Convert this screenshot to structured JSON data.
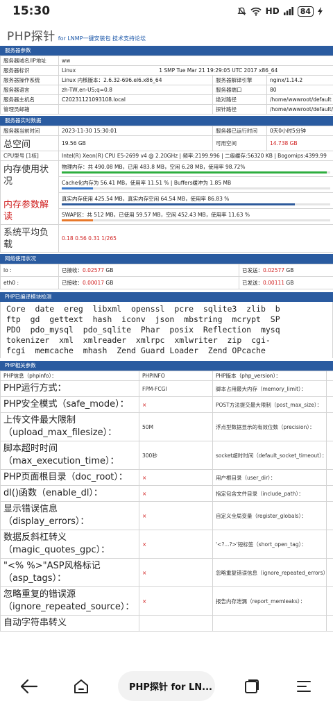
{
  "status_bar": {
    "time": "15:30",
    "network": "HD",
    "battery": "84"
  },
  "header": {
    "title": "PHP探针",
    "links": "for LNMP一键安装包 技术支持论坛"
  },
  "server_params": {
    "section": "服务器参数",
    "rows": [
      [
        "服务器域名/IP地址",
        "ww",
        "",
        ""
      ],
      [
        "服务器标识",
        "Linux",
        "1 SMP Tue Mar 21 19:29:05 UTC 2017 x86_64",
        ""
      ],
      [
        "服务器操作系统",
        "Linux 内核版本：2.6.32-696.el6.x86_64",
        "服务器解译引擎",
        "nginx/1.14.2"
      ],
      [
        "服务器语言",
        "zh-TW,en-US;q=0.8",
        "服务器端口",
        "80"
      ],
      [
        "服务器主机名",
        "C20231121093108.local",
        "绝对路径",
        "/home/wwwroot/default"
      ],
      [
        "管理员邮箱",
        "",
        "探针路径",
        "/home/wwwroot/default/p"
      ]
    ]
  },
  "realtime": {
    "section": "服务器实时数据",
    "time_label": "服务器当前时间",
    "time_value": "2023-11-30 15:30:01",
    "uptime_label": "服务器已运行时间",
    "uptime_value": "0天0小时5分钟",
    "space_label": "总空间",
    "space_value": "19.56 GB",
    "free_label": "可用空间",
    "free_value": "14.738 GB",
    "cpu_label": "CPU型号 [1核]",
    "cpu_value": "Intel(R) Xeon(R) CPU E5-2699 v4 @ 2.20GHz | 频率:2199.996 | 二级缓存:56320 KB | Bogomips:4399.99",
    "mem_label": "内存使用状况",
    "mem_physical": "物理内存：共 490.08 MB，已用 483.8 MB，空闲 6.28 MB，使用率 98.72%",
    "mem_cache": "Cache化内存为 56.41 MB，使用率 11.51 % | Buffers缓冲为 1.85 MB",
    "mem_real": "真实内存使用 425.54 MB，真实内存空闲 64.54 MB，使用率 86.83 %",
    "mem_swap": "SWAP区：共 512 MB，已使用 59.57 MB，空闲 452.43 MB，使用率 11.63 %",
    "mem_read_label": "内存参数解读",
    "load_label": "系统平均负载",
    "load_value": "0.18 0.56 0.31 1/265",
    "bars": {
      "physical": 98.72,
      "cache": 11.51,
      "real": 86.83,
      "swap": 11.63
    },
    "colors": {
      "physical": "#2eae3f",
      "cache": "#3a78c9",
      "real": "#2e5a9b",
      "swap": "#e8782a"
    }
  },
  "network": {
    "section": "网络使用状况",
    "rows": [
      [
        "lo :",
        "已接收：0.02577 GB",
        "已发送：0.02577 GB"
      ],
      [
        "eth0 :",
        "已接收：0.00017 GB",
        "已发送：0.00111 GB"
      ]
    ]
  },
  "modules": {
    "section": "PHP已编译模块检测",
    "lines": [
      "Core  date  ereg  libxml  openssl  pcre  sqlite3  zlib  b",
      "ftp  gd  gettext  hash  iconv  json  mbstring  mcrypt  SP",
      "PDO  pdo_mysql  pdo_sqlite  Phar  posix  Reflection  mysq",
      "tokenizer  xml  xmlreader  xmlrpc  xmlwriter  zip  cgi-",
      "fcgi  memcache  mhash  Zend Guard Loader  Zend OPcache"
    ]
  },
  "php_params": {
    "section": "PHP相关参数",
    "header": [
      "PHP信息（phpinfo）：",
      "PHPINFO",
      "PHP版本（php_version）：",
      ""
    ],
    "rows": [
      [
        "PHP运行方式：",
        "FPM-FCGI",
        "脚本占用最大内存（memory_limit）：",
        ""
      ],
      [
        "PHP安全模式（safe_mode）：",
        "×",
        "POST方法提交最大限制（post_max_size）：",
        ""
      ],
      [
        "上传文件最大限制（upload_max_filesize）：",
        "50M",
        "浮点型数据显示的有效位数（precision）：",
        ""
      ],
      [
        "脚本超时时间（max_execution_time）：",
        "300秒",
        "socket超时时间（default_socket_timeout）：",
        ""
      ],
      [
        "PHP页面根目录（doc_root）：",
        "×",
        "用户根目录（user_dir）：",
        ""
      ],
      [
        "dl()函数（enable_dl）：",
        "×",
        "指定包含文件目录（include_path）：",
        ""
      ],
      [
        "显示错误信息（display_errors）：",
        "×",
        "自定义全局变量（register_globals）：",
        ""
      ],
      [
        "数据反斜杠转义（magic_quotes_gpc）：",
        "×",
        "'<?...?>'短标签（short_open_tag）：",
        ""
      ],
      [
        "\"<% %>\"ASP风格标记（asp_tags）：",
        "×",
        "忽略重复错误信息（ignore_repeated_errors）：",
        ""
      ],
      [
        "忽略重复的错误源（ignore_repeated_source）：",
        "×",
        "报告内存泄漏（report_memleaks）：",
        ""
      ],
      [
        "自动字符串转义",
        "",
        "",
        ""
      ]
    ]
  },
  "bottom_nav": {
    "title": "PHP探针 for LN..."
  }
}
